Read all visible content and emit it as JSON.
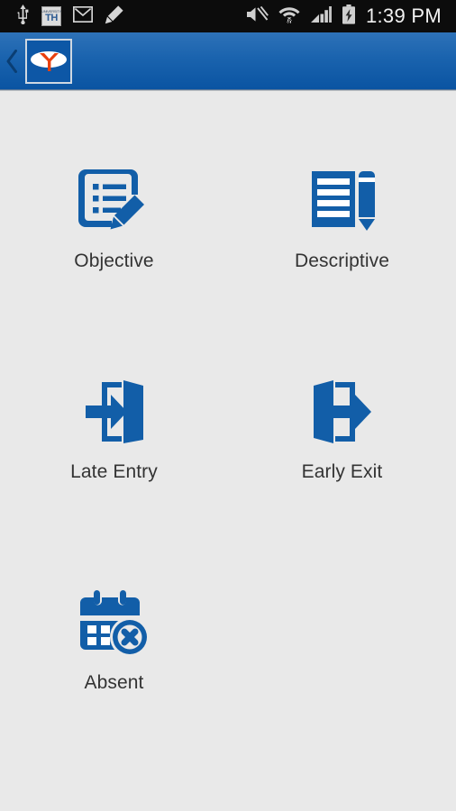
{
  "status_bar": {
    "left_icons": [
      {
        "name": "usb-icon",
        "label": "USB"
      },
      {
        "name": "app-badge-icon",
        "label": "TH",
        "badge_top": "UNIVERSITY"
      },
      {
        "name": "gmail-icon",
        "label": "M"
      },
      {
        "name": "edit-pencil-icon",
        "label": "Edit"
      }
    ],
    "right_icons": [
      {
        "name": "mute-icon",
        "label": "Sound off"
      },
      {
        "name": "wifi-icon",
        "label": "Wi-Fi"
      },
      {
        "name": "cellular-signal-icon",
        "label": "Signal"
      },
      {
        "name": "battery-charging-icon",
        "label": "Battery charging"
      }
    ],
    "time": "1:39 PM"
  },
  "app_bar": {
    "back_label": "‹",
    "logo_alt": "App logo"
  },
  "menu": {
    "items": [
      {
        "id": "objective",
        "label": "Objective",
        "icon": "list-edit-icon"
      },
      {
        "id": "descriptive",
        "label": "Descriptive",
        "icon": "document-pencil-icon"
      },
      {
        "id": "late-entry",
        "label": "Late Entry",
        "icon": "door-enter-icon"
      },
      {
        "id": "early-exit",
        "label": "Early Exit",
        "icon": "door-exit-icon"
      },
      {
        "id": "absent",
        "label": "Absent",
        "icon": "calendar-x-icon"
      }
    ]
  },
  "colors": {
    "brand_blue": "#0d57a6",
    "icon_blue": "#125ea8",
    "appbar_top": "#2e72b8",
    "appbar_bottom": "#0a54a2",
    "background": "#e9e9e9",
    "label_text": "#333333",
    "logo_accent": "#e8400f"
  }
}
